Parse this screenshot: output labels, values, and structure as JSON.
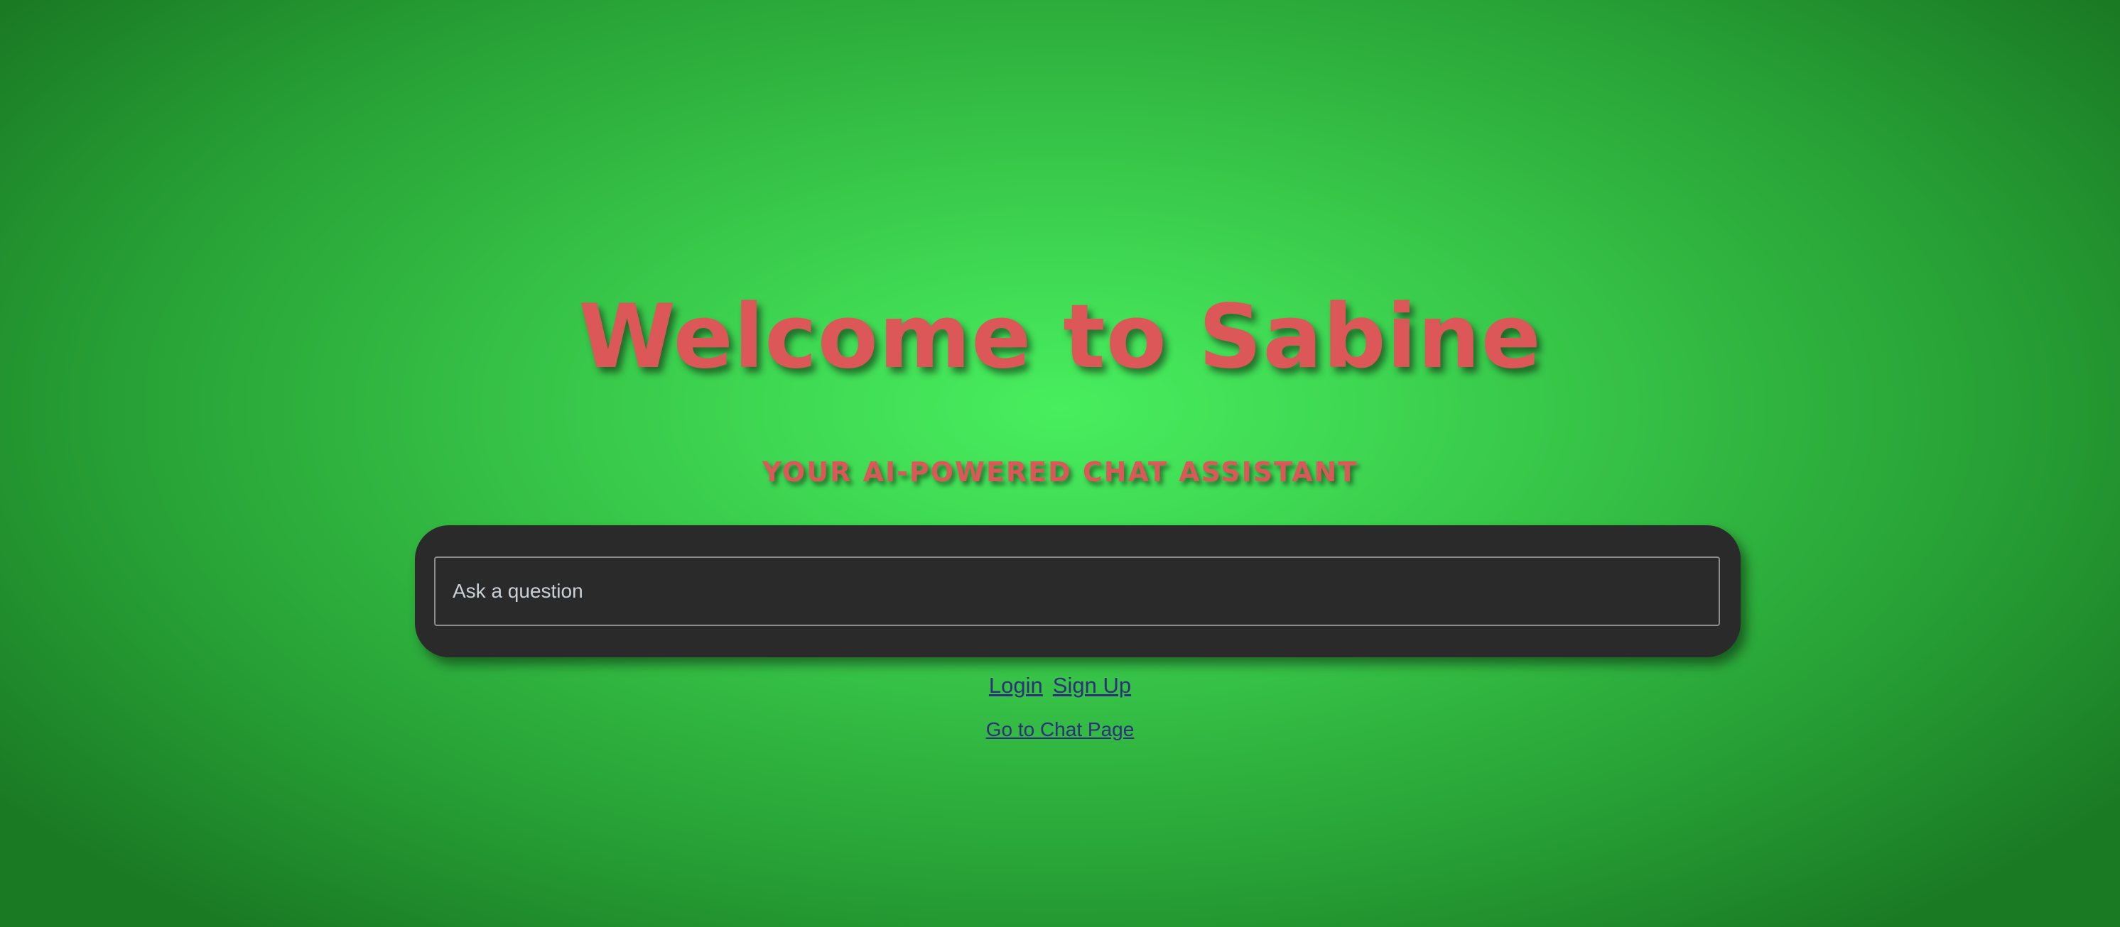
{
  "hero": {
    "title": "Welcome to Sabine",
    "subtitle": "YOUR AI-POWERED CHAT ASSISTANT"
  },
  "search": {
    "placeholder": "Ask a question",
    "value": ""
  },
  "auth": {
    "login_label": "Login",
    "signup_label": "Sign Up"
  },
  "nav": {
    "chat_page_label": "Go to Chat Page"
  },
  "colors": {
    "background_center": "#48ee5e",
    "background_edge": "#1a7a24",
    "title_text": "#dc5757",
    "panel": "#2a2a2a",
    "link": "#2f2f7a"
  }
}
